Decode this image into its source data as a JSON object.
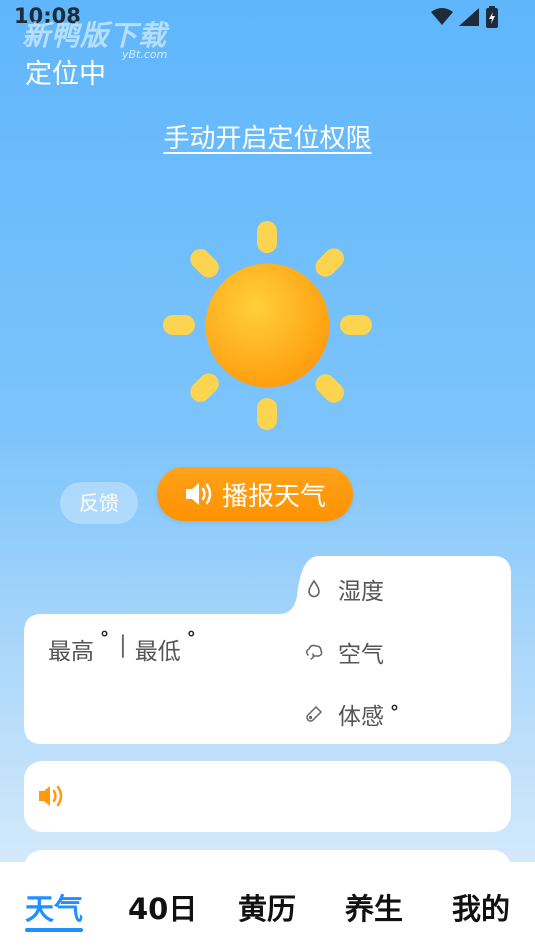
{
  "status_bar": {
    "time": "10:08",
    "icons": [
      "wifi-icon",
      "signal-icon",
      "battery-icon"
    ]
  },
  "watermark": {
    "text": "新鸭版下载",
    "sub": "yBt.com"
  },
  "header": {
    "location": "定位中",
    "permission_link": "手动开启定位权限"
  },
  "actions": {
    "feedback": "反馈",
    "broadcast": "播报天气"
  },
  "weather": {
    "high_label": "最高",
    "low_label": "最低",
    "degree_symbol": "°",
    "separator": "|",
    "humidity_label": "湿度",
    "air_label": "空气",
    "feels_label": "体感"
  },
  "tabs": [
    {
      "label": "天气",
      "active": true
    },
    {
      "label": "40日",
      "active": false
    },
    {
      "label": "黄历",
      "active": false
    },
    {
      "label": "养生",
      "active": false
    },
    {
      "label": "我的",
      "active": false
    }
  ],
  "colors": {
    "accent": "#1e90ff",
    "orange": "#ff9a0e",
    "sun_ray": "#fdd44f"
  }
}
